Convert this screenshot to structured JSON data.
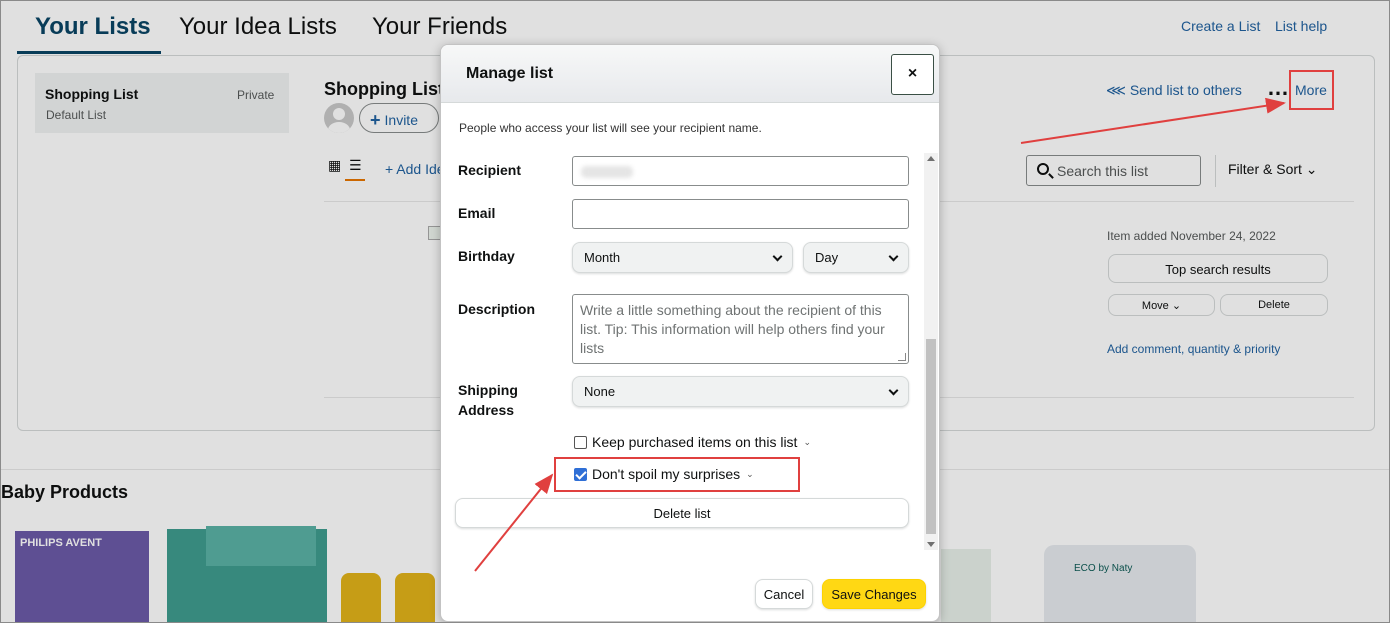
{
  "tabs": [
    {
      "label": "Your Lists",
      "active": true
    },
    {
      "label": "Your Idea Lists"
    },
    {
      "label": "Your Friends"
    }
  ],
  "header_links": {
    "create": "Create a List",
    "help": "List help"
  },
  "sidebar": {
    "title": "Shopping List",
    "subtitle": "Default List",
    "privacy": "Private"
  },
  "list": {
    "title": "Shopping List",
    "invite": "Invite",
    "add_idea": "+ Add Idea",
    "send": "Send list to others",
    "more": "More",
    "search_placeholder": "Search this list",
    "filter": "Filter & Sort",
    "item_added": "Item added November 24, 2022",
    "top_search": "Top search results",
    "move": "Move",
    "delete": "Delete",
    "comment": "Add comment, quantity & priority"
  },
  "section": {
    "title": "Baby Products",
    "product_brand_1": "PHILIPS AVENT",
    "product_brand_2": "ECO by Naty"
  },
  "modal": {
    "title": "Manage list",
    "close": "×",
    "note": "People who access your list will see your recipient name.",
    "recipient_label": "Recipient",
    "email_label": "Email",
    "birthday_label": "Birthday",
    "month": "Month",
    "day": "Day",
    "description_label": "Description",
    "description_placeholder": "Write a little something about the recipient of this list. Tip: This information will help others find your lists",
    "shipping_label_1": "Shipping",
    "shipping_label_2": "Address",
    "shipping_value": "None",
    "keep_purchased": "Keep purchased items on this list",
    "dont_spoil": "Don't spoil my surprises",
    "delete_list": "Delete list",
    "cancel": "Cancel",
    "save": "Save Changes"
  },
  "colors": {
    "annotation": "#e0403f",
    "save_button": "#ffd814",
    "link": "#2162a1",
    "active_tab": "#0a4565"
  }
}
